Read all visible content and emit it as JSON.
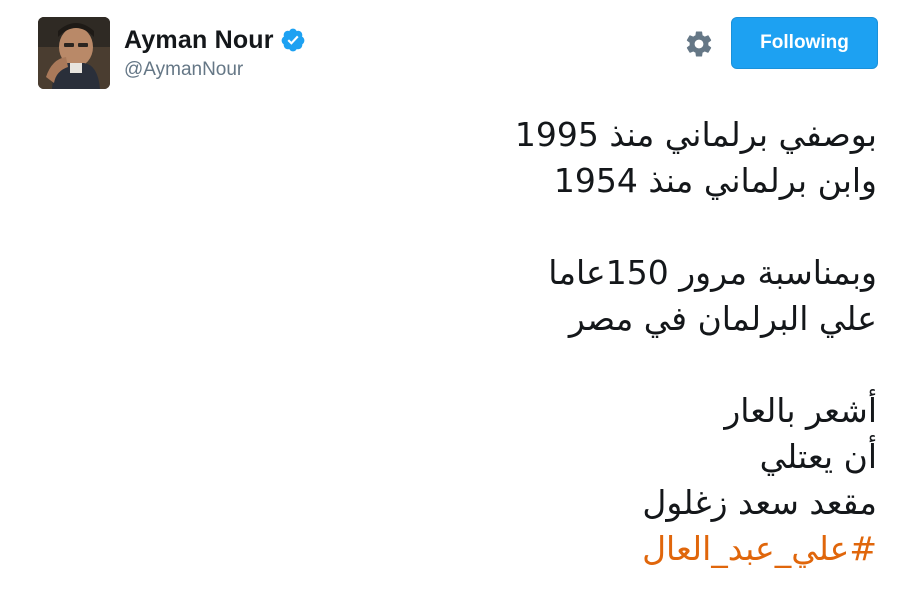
{
  "author": {
    "name": "Ayman Nour",
    "handle": "@AymanNour",
    "verified": true
  },
  "actions": {
    "follow_label": "Following"
  },
  "tweet": {
    "lines": [
      "بوصفي برلماني منذ 1995",
      "وابن برلماني منذ 1954",
      "",
      "وبمناسبة مرور 150عاما",
      "علي البرلمان في مصر",
      "",
      "أشعر بالعار",
      "أن يعتلي",
      "مقعد سعد زغلول"
    ],
    "hashtag": "#علي_عبد_العال"
  },
  "colors": {
    "follow_button": "#1da1f2",
    "verified_badge": "#1da1f2",
    "hashtag": "#e0660b",
    "handle": "#657786"
  },
  "icons": {
    "settings": "gear-icon",
    "verified": "verified-badge-icon"
  }
}
